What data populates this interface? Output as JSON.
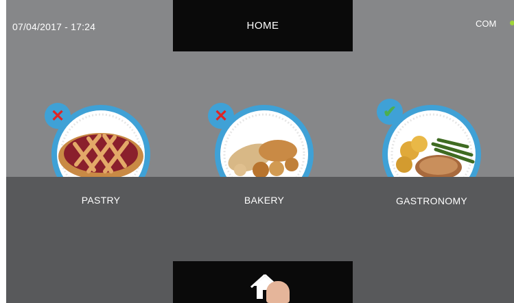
{
  "header": {
    "datetime": "07/04/2017 - 17:24",
    "title": "HOME",
    "connection_label": "COM",
    "connection_color": "#9fd43a"
  },
  "categories": [
    {
      "label": "PASTRY",
      "status": "disabled",
      "status_icon": "close-icon",
      "image": "lattice-pie"
    },
    {
      "label": "BAKERY",
      "status": "disabled",
      "status_icon": "close-icon",
      "image": "bread-rolls"
    },
    {
      "label": "GASTRONOMY",
      "status": "enabled",
      "status_icon": "check-icon",
      "image": "grilled-meat-potatoes-beans"
    }
  ],
  "footer": {
    "home_icon": "home-icon"
  },
  "colors": {
    "accent_blue": "#3fa1d6",
    "disabled_red": "#e02424",
    "enabled_green": "#4caf50",
    "panel_black": "#0a0a0a"
  }
}
